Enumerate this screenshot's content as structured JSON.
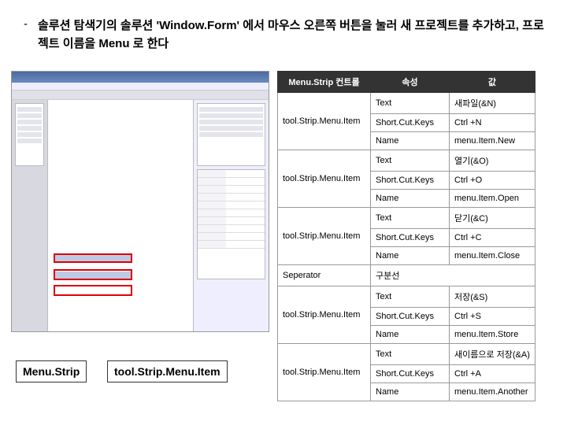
{
  "instruction": {
    "dash": "-",
    "text": "솔루션 탐색기의 솔루션 'Window.Form' 에서 마우스 오른쪽 버튼을 눌러 새 프로젝트를 추가하고, 프로젝트 이름을 Menu 로 한다"
  },
  "labels": {
    "menu_strip": "Menu.Strip",
    "tool_item": "tool.Strip.Menu.Item"
  },
  "table": {
    "headers": {
      "control": "Menu.Strip 컨트롤",
      "property": "속성",
      "value": "값"
    },
    "rows": [
      {
        "control": "tool.Strip.Menu.Item",
        "property": "Text",
        "value": "새파일(&N)"
      },
      {
        "control": "",
        "property": "Short.Cut.Keys",
        "value": "Ctrl +N"
      },
      {
        "control": "",
        "property": "Name",
        "value": "menu.Item.New"
      },
      {
        "control": "tool.Strip.Menu.Item",
        "property": "Text",
        "value": "열기(&O)"
      },
      {
        "control": "",
        "property": "Short.Cut.Keys",
        "value": "Ctrl +O"
      },
      {
        "control": "",
        "property": "Name",
        "value": "menu.Item.Open"
      },
      {
        "control": "tool.Strip.Menu.Item",
        "property": "Text",
        "value": "닫기(&C)"
      },
      {
        "control": "",
        "property": "Short.Cut.Keys",
        "value": "Ctrl +C"
      },
      {
        "control": "",
        "property": "Name",
        "value": "menu.Item.Close"
      },
      {
        "control": "Seperator",
        "property": "구분선",
        "value": ""
      },
      {
        "control": "tool.Strip.Menu.Item",
        "property": "Text",
        "value": "저장(&S)"
      },
      {
        "control": "",
        "property": "Short.Cut.Keys",
        "value": "Ctrl +S"
      },
      {
        "control": "",
        "property": "Name",
        "value": "menu.Item.Store"
      },
      {
        "control": "tool.Strip.Menu.Item",
        "property": "Text",
        "value": "새이름으로 저장(&A)"
      },
      {
        "control": "",
        "property": "Short.Cut.Keys",
        "value": "Ctrl +A"
      },
      {
        "control": "",
        "property": "Name",
        "value": "menu.Item.Another"
      }
    ]
  }
}
